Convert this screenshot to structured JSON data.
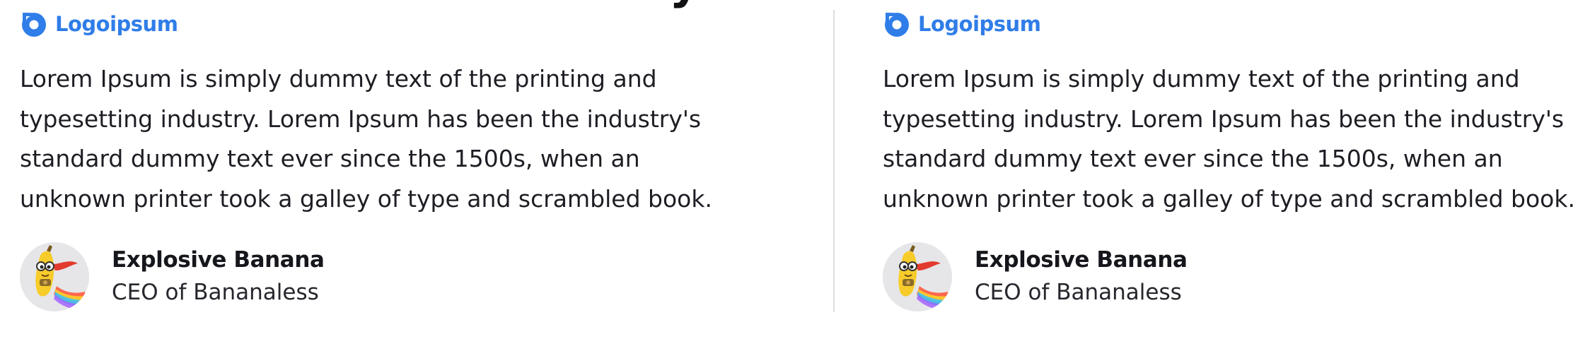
{
  "section": {
    "heading": "Testimony"
  },
  "testimonials": [
    {
      "logo_text": "Logoipsum",
      "quote": "Lorem Ipsum is simply dummy text of the printing and typesetting industry. Lorem Ipsum has been the industry's standard dummy text ever since the 1500s, when an unknown printer took a galley of type and scrambled book.",
      "author_name": "Explosive Banana",
      "author_role": "CEO of Bananaless",
      "avatar_icon": "superhero-banana-avatar"
    },
    {
      "logo_text": "Logoipsum",
      "quote": "Lorem Ipsum is simply dummy text of the printing and typesetting industry. Lorem Ipsum has been the industry's standard dummy text ever since the 1500s, when an unknown printer took a galley of type and scrambled book.",
      "author_name": "Explosive Banana",
      "author_role": "CEO of Bananaless",
      "avatar_icon": "superhero-banana-avatar"
    }
  ],
  "colors": {
    "brand": "#2f7de8",
    "text": "#1d1e24",
    "divider": "#dedee3",
    "avatar_bg": "#e6e6e9"
  },
  "icons": {
    "logo": "logoipsum-logo-icon"
  }
}
